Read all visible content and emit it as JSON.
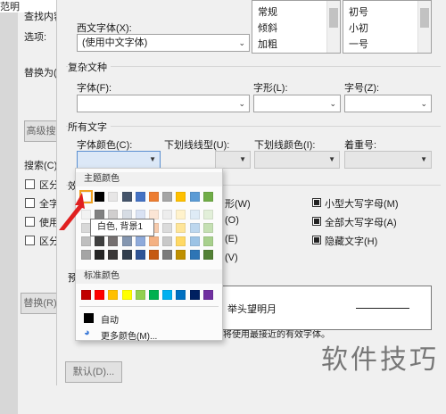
{
  "background_dialog": {
    "title_fragment": "范明",
    "find_label": "查找内容",
    "options_label": "选项:",
    "replace_label": "替换为(I",
    "advanced_button": "高级搜",
    "search_label": "搜索(C)",
    "checkbox_labels": [
      "区分",
      "全字",
      "使用",
      "区分"
    ],
    "replace_all_button": "替换(R)"
  },
  "font_dialog": {
    "western_font_label": "西文字体(X):",
    "western_font_value": "(使用中文字体)",
    "style_list": [
      "常规",
      "倾斜",
      "加粗"
    ],
    "size_list": [
      "初号",
      "小初",
      "一号"
    ],
    "complex_section": "复杂文种",
    "complex_font_label": "字体(F):",
    "complex_style_label": "字形(L):",
    "complex_size_label": "字号(Z):",
    "all_text_section": "所有文字",
    "font_color_label": "字体颜色(C):",
    "underline_style_label": "下划线线型(U):",
    "underline_color_label": "下划线颜色(I):",
    "emphasis_label": "着重号:",
    "effects_section_fragment": "效",
    "effects_left": [
      {
        "label": "形(W)"
      },
      {
        "label": "(O)"
      },
      {
        "label": "(E)"
      },
      {
        "label": "(V)"
      }
    ],
    "effects_right": [
      {
        "label": "小型大写字母(M)",
        "checked": true
      },
      {
        "label": "全部大写字母(A)",
        "checked": true
      },
      {
        "label": "隐藏文字(H)",
        "checked": true
      }
    ],
    "preview_section_fragment": "预",
    "preview_text": "举头望明月",
    "note_text": "将使用最接近的有效字体。",
    "note_prefix_fragment": "...",
    "default_button": "默认(D)..."
  },
  "color_popup": {
    "theme_colors_title": "主题颜色",
    "standard_colors_title": "标准颜色",
    "auto_label": "自动",
    "more_colors_label": "更多颜色(M)...",
    "tooltip": "白色, 背景1",
    "theme_top_row": [
      "#ffffff",
      "#000000",
      "#e7e6e6",
      "#44546a",
      "#4472c4",
      "#ed7d31",
      "#a5a5a5",
      "#ffc000",
      "#5b9bd5",
      "#70ad47"
    ],
    "theme_shades": [
      [
        "#f2f2f2",
        "#808080",
        "#d0cece",
        "#d6dce4",
        "#d9e2f3",
        "#fbe5d5",
        "#ededed",
        "#fff2cc",
        "#deebf6",
        "#e2efd9"
      ],
      [
        "#d8d8d8",
        "#595959",
        "#aeaaaa",
        "#adb9ca",
        "#b4c6e7",
        "#f7cbac",
        "#dbdbdb",
        "#fee599",
        "#bdd7ee",
        "#c5e0b3"
      ],
      [
        "#bfbfbf",
        "#3f3f3f",
        "#757070",
        "#8496b0",
        "#8eaadb",
        "#f4b183",
        "#c9c9c9",
        "#ffd965",
        "#9cc3e5",
        "#a8d08d"
      ],
      [
        "#a5a5a5",
        "#262626",
        "#3a3838",
        "#323f4f",
        "#2f5496",
        "#c55a11",
        "#7b7b7b",
        "#bf9000",
        "#2e75b5",
        "#538135"
      ]
    ],
    "standard_colors": [
      "#c00000",
      "#ff0000",
      "#ffc000",
      "#ffff00",
      "#92d050",
      "#00b050",
      "#00b0f0",
      "#0070c0",
      "#002060",
      "#7030a0"
    ],
    "auto_color": "#000000"
  },
  "watermark": "软件技巧",
  "colors": {
    "dialog_bg": "#f0f0f0",
    "selection_outline": "#f0a020",
    "arrow_red": "#e02020"
  }
}
